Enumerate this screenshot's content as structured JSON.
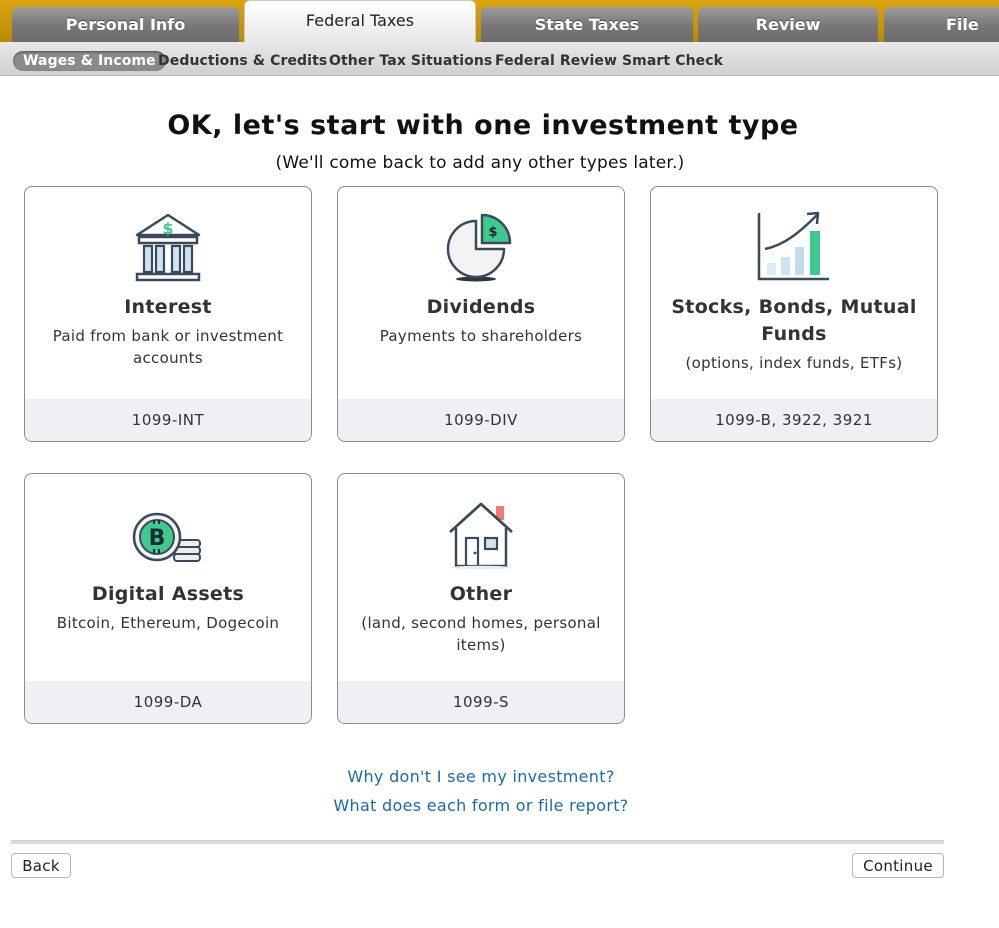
{
  "top_tabs": [
    {
      "label": "Personal Info",
      "active": false
    },
    {
      "label": "Federal Taxes",
      "active": true
    },
    {
      "label": "State Taxes",
      "active": false
    },
    {
      "label": "Review",
      "active": false
    },
    {
      "label": "File",
      "active": false
    }
  ],
  "sub_tabs": [
    {
      "label": "Wages & Income",
      "active": true
    },
    {
      "label": "Deductions & Credits",
      "active": false
    },
    {
      "label": "Other Tax Situations",
      "active": false
    },
    {
      "label": "Federal Review",
      "active": false
    },
    {
      "label": "Smart Check",
      "active": false
    }
  ],
  "heading": "OK, let's start with one investment type",
  "subheading": "(We'll come back to add any other types later.)",
  "cards": [
    {
      "title": "Interest",
      "description": "Paid from bank or investment accounts",
      "forms": "1099-INT",
      "icon": "bank-icon"
    },
    {
      "title": "Dividends",
      "description": "Payments to shareholders",
      "forms": "1099-DIV",
      "icon": "pie-chart-dollar-icon"
    },
    {
      "title": "Stocks, Bonds, Mutual Funds",
      "description": "(options, index funds, ETFs)",
      "forms": "1099-B, 3922, 3921",
      "icon": "growth-chart-icon"
    },
    {
      "title": "Digital Assets",
      "description": "Bitcoin, Ethereum, Dogecoin",
      "forms": "1099-DA",
      "icon": "bitcoin-coins-icon"
    },
    {
      "title": "Other",
      "description": "(land, second homes, personal items)",
      "forms": "1099-S",
      "icon": "house-icon"
    }
  ],
  "links": {
    "why_not_see": "Why don't I see my investment?",
    "what_each_form": "What does each form or file report?"
  },
  "buttons": {
    "back": "Back",
    "continue": "Continue"
  },
  "colors": {
    "tab_bar_gold": "#c99a0c",
    "accent_green": "#3fc98e",
    "link_blue": "#1a6aa6",
    "icon_navy": "#3b4a5a"
  }
}
